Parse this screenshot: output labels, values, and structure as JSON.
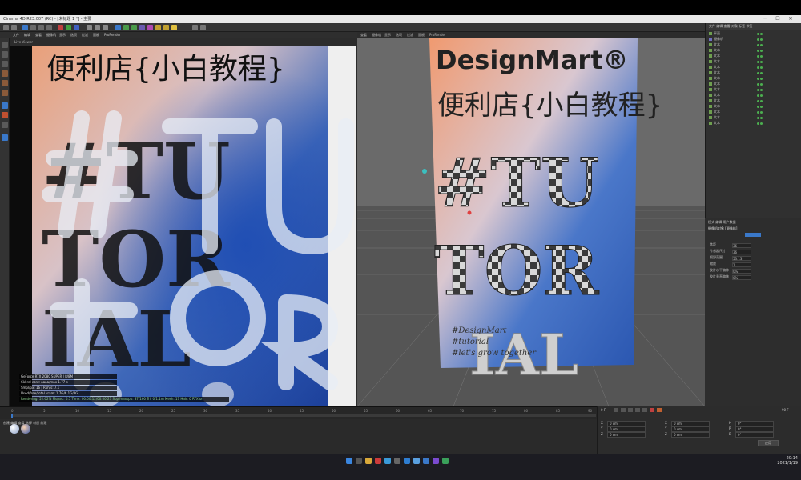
{
  "window": {
    "title": "Cinema 4D R23.007 (RC) - [未标题 1 *] - 主要",
    "minimize": "─",
    "maximize": "☐",
    "close": "✕"
  },
  "menu": {
    "left": [
      "文件",
      "编辑",
      "查看",
      "摄像机",
      "显示",
      "选项",
      "过滤",
      "面板",
      "ProRender"
    ],
    "viewport2": [
      "查看",
      "摄像机",
      "显示",
      "选项",
      "过滤",
      "面板",
      "ProRender"
    ]
  },
  "objects": [
    "平面",
    "摄像机",
    "文本",
    "文本",
    "文本",
    "文本",
    "文本",
    "文本",
    "文本",
    "文本",
    "文本",
    "文本",
    "文本",
    "文本",
    "文本",
    "文本",
    "文本"
  ],
  "attributes": {
    "tabs": [
      "模式",
      "编辑",
      "用户数据"
    ],
    "header": "摄像机对象 [摄像机]",
    "rows": [
      {
        "label": "焦距",
        "value": "36"
      },
      {
        "label": "传感器尺寸",
        "value": "36"
      },
      {
        "label": "视野范围",
        "value": "53.13°"
      },
      {
        "label": "缩放",
        "value": "1"
      },
      {
        "label": "胶片水平偏移",
        "value": "0%"
      },
      {
        "label": "胶片垂直偏移",
        "value": "0%"
      }
    ]
  },
  "viewport1": {
    "poster_title": "便利店{小白教程}",
    "big_text": [
      "#TU",
      "TOR",
      "IAL"
    ],
    "hud": [
      "GeForce RTX 2080 SUPER | 8/8M",
      "Ckl rel cont: aaaa/max 1.77 s",
      "Smpl/px: 16 | Rph/s: 7.1",
      "Used/free/total vram: 1.7G/6.1G/8G",
      "Rendering: 52.62%   Ms/sec: 0.5   Time: 00:00:12/00:00:23   Spp/maxspp: 87/160   Tri: 0/1.1m   Mesh: 17   Hair: 0   RTX:on"
    ]
  },
  "viewport2": {
    "brand": "DesignMart®",
    "poster_title": "便利店{小白教程}",
    "big_text": [
      "#TU",
      "TOR",
      "IAL"
    ],
    "small_lines": [
      "#DesignMart",
      "#tutorial",
      "#let's grow together"
    ]
  },
  "timeline": {
    "start": "0 F",
    "end": "90 F",
    "ticks": [
      "0",
      "5",
      "10",
      "15",
      "20",
      "25",
      "30",
      "35",
      "40",
      "45",
      "50",
      "55",
      "60",
      "65",
      "70",
      "75",
      "80",
      "85",
      "90"
    ]
  },
  "coords": {
    "rows": [
      {
        "a": "X",
        "va": "0 cm",
        "b": "X",
        "vb": "0 cm",
        "c": "H",
        "vc": "0°"
      },
      {
        "a": "Y",
        "va": "0 cm",
        "b": "Y",
        "vb": "0 cm",
        "c": "P",
        "vc": "0°"
      },
      {
        "a": "Z",
        "va": "0 cm",
        "b": "Z",
        "vb": "0 cm",
        "c": "B",
        "vc": "0°"
      }
    ],
    "apply": "应用"
  },
  "taskbar": {
    "time": "20:14",
    "date": "2021/1/19"
  },
  "colors": {
    "accent": "#3a78c9",
    "green": "#4caf50"
  }
}
